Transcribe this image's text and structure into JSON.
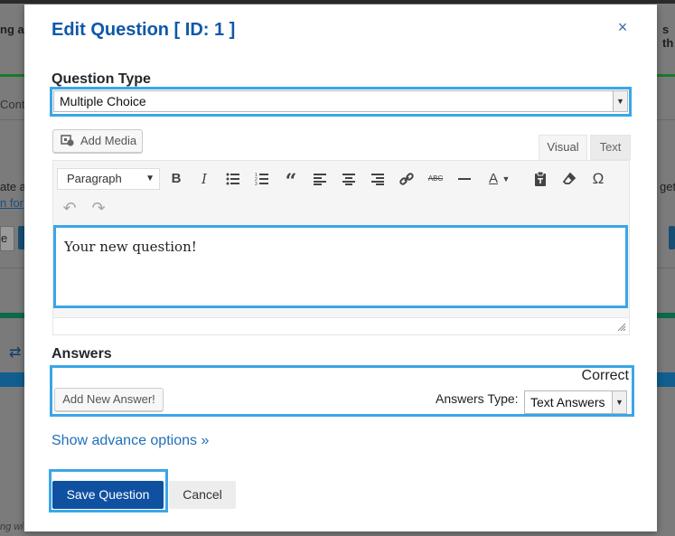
{
  "modal": {
    "title": "Edit Question [ ID: 1 ]",
    "close_symbol": "×"
  },
  "question_type": {
    "label": "Question Type",
    "selected": "Multiple Choice"
  },
  "editor": {
    "add_media_label": "Add Media",
    "tab_visual": "Visual",
    "tab_text": "Text",
    "format_selected": "Paragraph",
    "toolbar_icons": [
      "bold-icon",
      "italic-icon",
      "bullet-list-icon",
      "numbered-list-icon",
      "blockquote-icon",
      "align-left-icon",
      "align-center-icon",
      "align-right-icon",
      "link-icon",
      "strikethrough-icon",
      "horizontal-rule-icon",
      "text-color-icon",
      "paste-text-icon",
      "clear-formatting-icon",
      "special-character-icon",
      "undo-icon",
      "redo-icon"
    ],
    "content": "Your new question!"
  },
  "answers": {
    "label": "Answers",
    "correct_label": "Correct",
    "add_button": "Add New Answer!",
    "type_label": "Answers Type:",
    "type_selected": "Text Answers"
  },
  "advance_link": "Show advance options »",
  "buttons": {
    "save": "Save Question",
    "cancel": "Cancel"
  },
  "background": {
    "fragments": [
      "ng a",
      "s th",
      "Conta",
      "ate a",
      "n for",
      "get",
      "e"
    ]
  },
  "colors": {
    "accent": "#0e58a8",
    "highlight": "#3aa6e8",
    "primary_button": "#0f51a0"
  }
}
